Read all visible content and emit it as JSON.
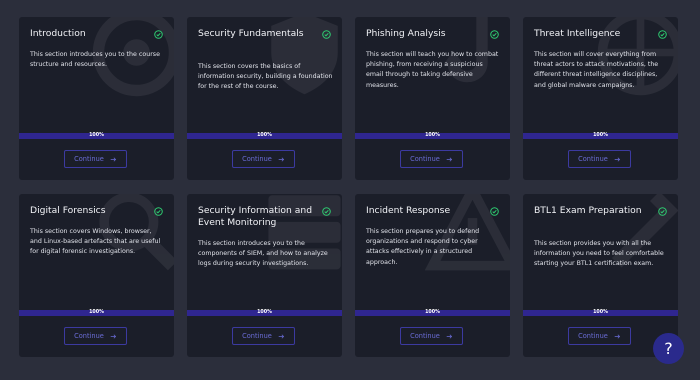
{
  "icons": {
    "completed": "check-circle-icon",
    "continue": "arrow-right-icon",
    "help": "question-mark-icon"
  },
  "colors": {
    "accent": "#2f2690",
    "card": "#1b1e29",
    "background": "#2b2e3b",
    "check": "#2ecc71",
    "button": "#6a6cd6"
  },
  "cards": [
    {
      "title": "Introduction",
      "description": "This section introduces you to the course structure and resources.",
      "progress_text": "100%",
      "progress": 1.0,
      "button_label": "Continue"
    },
    {
      "title": "Security Fundamentals",
      "description": "This section covers the basics of information security, building a foundation for the rest of the course.",
      "progress_text": "100%",
      "progress": 1.0,
      "button_label": "Continue"
    },
    {
      "title": "Phishing Analysis",
      "description": "This section will teach you how to combat phishing, from receiving a suspicious email through to taking defensive measures.",
      "progress_text": "100%",
      "progress": 1.0,
      "button_label": "Continue"
    },
    {
      "title": "Threat Intelligence",
      "description": "This section will cover everything from threat actors to attack motivations, the different threat intelligence disciplines, and global malware campaigns.",
      "progress_text": "100%",
      "progress": 1.0,
      "button_label": "Continue"
    },
    {
      "title": "Digital Forensics",
      "description": "This section covers Windows, browser, and Linux-based artefacts that are useful for digital forensic investigations.",
      "progress_text": "100%",
      "progress": 1.0,
      "button_label": "Continue"
    },
    {
      "title": "Security Information and Event Monitoring",
      "description": "This section introduces you to the components of SIEM, and how to analyze logs during security investigations.",
      "progress_text": "100%",
      "progress": 1.0,
      "button_label": "Continue"
    },
    {
      "title": "Incident Response",
      "description": "This section prepares you to defend organizations and respond to cyber attacks effectively in a structured approach.",
      "progress_text": "100%",
      "progress": 1.0,
      "button_label": "Continue"
    },
    {
      "title": "BTL1 Exam Preparation",
      "description": "This section provides you with all the information you need to feel comfortable starting your BTL1 certification exam.",
      "progress_text": "100%",
      "progress": 1.0,
      "button_label": "Continue"
    }
  ],
  "help_button": {
    "label": "?"
  }
}
